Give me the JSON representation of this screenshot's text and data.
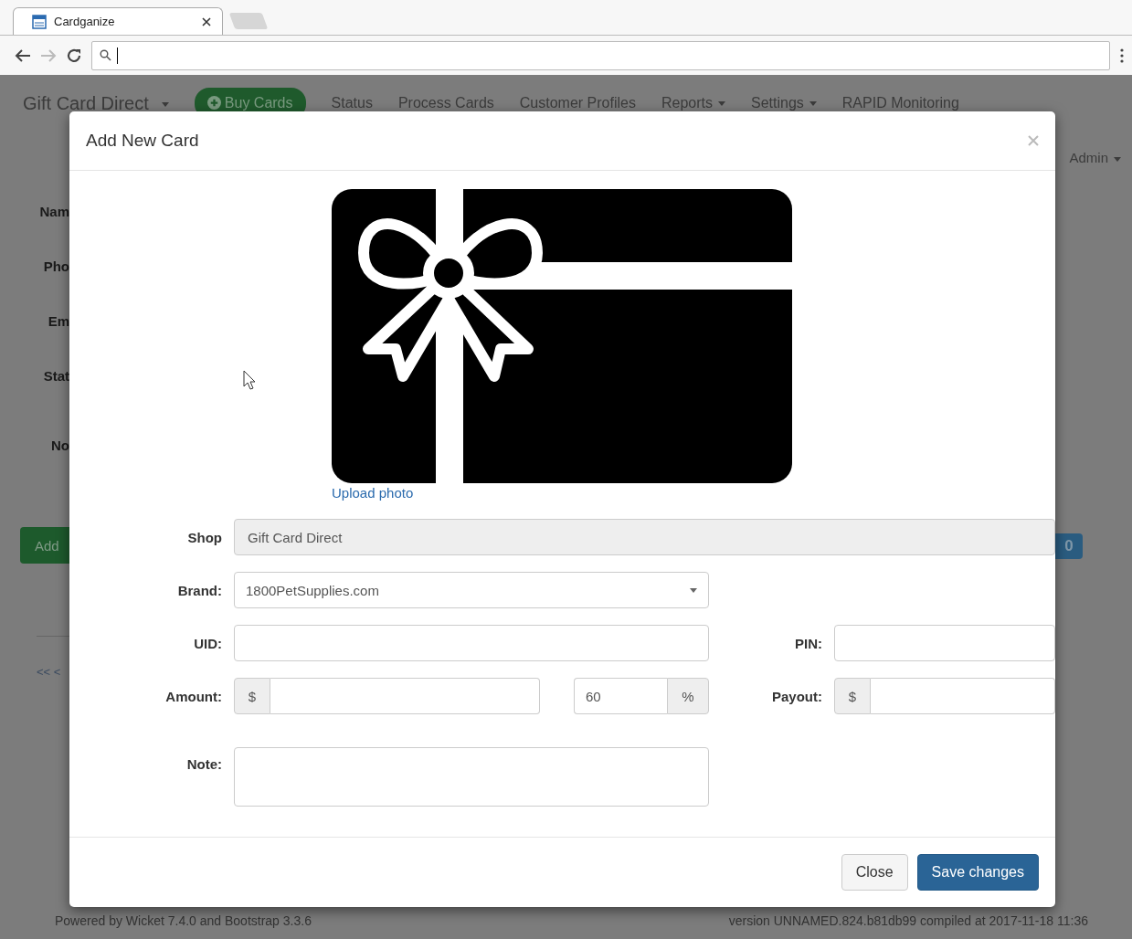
{
  "browser": {
    "tab_title": "Cardganize"
  },
  "page": {
    "brand": "Gift Card Direct",
    "nav": [
      {
        "label": "Buy Cards",
        "kind": "button"
      },
      {
        "label": "Status",
        "kind": "link"
      },
      {
        "label": "Process Cards",
        "kind": "link"
      },
      {
        "label": "Customer Profiles",
        "kind": "link"
      },
      {
        "label": "Reports",
        "kind": "dropdown"
      },
      {
        "label": "Settings",
        "kind": "dropdown"
      },
      {
        "label": "RAPID Monitoring",
        "kind": "link"
      }
    ],
    "user": "Admin",
    "form_labels": [
      "Nam",
      "Pho",
      "Em",
      "Stat",
      "No"
    ],
    "add_button": "Add",
    "pager": "<< <",
    "go_button": "0",
    "footer_left": "Powered by Wicket 7.4.0 and Bootstrap 3.3.6",
    "footer_right": "version UNNAMED.824.b81db99 compiled at 2017-11-18 11:36"
  },
  "modal": {
    "title": "Add New Card",
    "upload_link": "Upload photo",
    "shop": {
      "label": "Shop",
      "value": "Gift Card Direct",
      "disabled": true
    },
    "brand": {
      "label": "Brand:",
      "value": "1800PetSupplies.com"
    },
    "uid": {
      "label": "UID:"
    },
    "pin": {
      "label": "PIN:"
    },
    "amount": {
      "label": "Amount:",
      "prefix": "$"
    },
    "percent": {
      "value": "60",
      "suffix": "%"
    },
    "payout": {
      "label": "Payout:",
      "prefix": "$"
    },
    "note": {
      "label": "Note:"
    },
    "buttons": [
      {
        "label": "Close",
        "kind": "default"
      },
      {
        "label": "Save changes",
        "kind": "primary"
      }
    ]
  }
}
